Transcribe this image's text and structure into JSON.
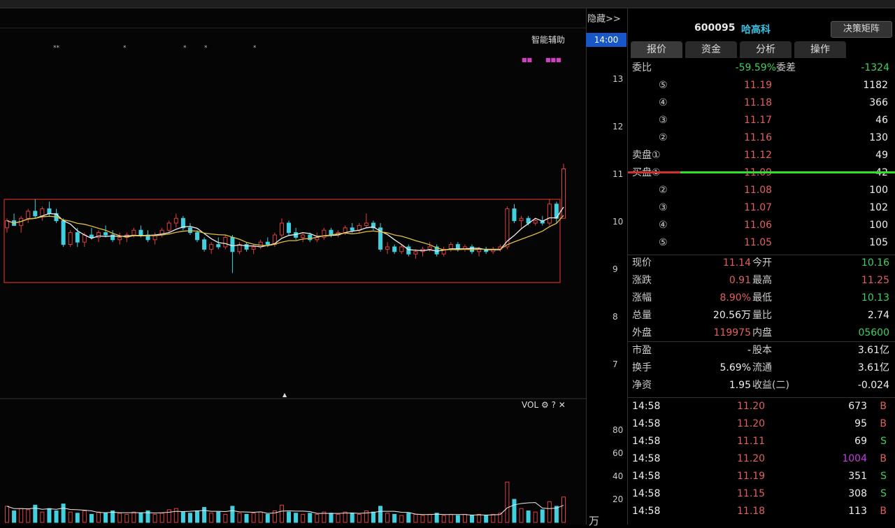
{
  "header": {
    "hide_label": "隐藏>>",
    "time_badge": "14:00",
    "smart_label": "智能辅助",
    "markers": [
      "**",
      "*",
      "*",
      "*",
      "*"
    ],
    "mag_labels": [
      "■■",
      "■■■"
    ]
  },
  "stock": {
    "code": "600095",
    "name": "哈高科",
    "matrix_button": "决策矩阵"
  },
  "tabs": [
    {
      "label": "报价"
    },
    {
      "label": "资金"
    },
    {
      "label": "分析"
    },
    {
      "label": "操作"
    }
  ],
  "ratio": {
    "label": "委比",
    "value": "-59.59%",
    "diff_label": "委差",
    "diff_value": "-1324"
  },
  "sell": [
    {
      "level": "⑤",
      "price": "11.19",
      "vol": "1182"
    },
    {
      "level": "④",
      "price": "11.18",
      "vol": "366"
    },
    {
      "level": "③",
      "price": "11.17",
      "vol": "46"
    },
    {
      "level": "②",
      "price": "11.16",
      "vol": "130"
    },
    {
      "level": "卖盘①",
      "price": "11.12",
      "vol": "49"
    }
  ],
  "buy": [
    {
      "level": "买盘①",
      "price": "11.09",
      "vol": "42"
    },
    {
      "level": "②",
      "price": "11.08",
      "vol": "100"
    },
    {
      "level": "③",
      "price": "11.07",
      "vol": "102"
    },
    {
      "level": "④",
      "price": "11.06",
      "vol": "100"
    },
    {
      "level": "⑤",
      "price": "11.05",
      "vol": "105"
    }
  ],
  "stats": [
    {
      "l1": "现价",
      "v1": "11.14",
      "c1": "red",
      "l2": "今开",
      "v2": "10.16",
      "c2": "grn"
    },
    {
      "l1": "涨跌",
      "v1": "0.91",
      "c1": "red",
      "l2": "最高",
      "v2": "11.25",
      "c2": "red"
    },
    {
      "l1": "涨幅",
      "v1": "8.90%",
      "c1": "red",
      "l2": "最低",
      "v2": "10.13",
      "c2": "grn"
    },
    {
      "l1": "总量",
      "v1": "20.56万",
      "c1": "wht",
      "l2": "量比",
      "v2": "2.74",
      "c2": "wht"
    },
    {
      "l1": "外盘",
      "v1": "119975",
      "c1": "red",
      "l2": "内盘",
      "v2": "05600",
      "c2": "grn"
    },
    {
      "l1": "市盈",
      "v1": "-",
      "c1": "wht",
      "l2": "股本",
      "v2": "3.61亿",
      "c2": "wht"
    },
    {
      "l1": "换手",
      "v1": "5.69%",
      "c1": "wht",
      "l2": "流通",
      "v2": "3.61亿",
      "c2": "wht"
    },
    {
      "l1": "净资",
      "v1": "1.95",
      "c1": "wht",
      "l2": "收益(二)",
      "v2": "-0.024",
      "c2": "wht"
    }
  ],
  "trades": [
    {
      "time": "14:58",
      "price": "11.20",
      "vol": "673",
      "bs": "B",
      "vc": "wht"
    },
    {
      "time": "14:58",
      "price": "11.20",
      "vol": "95",
      "bs": "B",
      "vc": "wht"
    },
    {
      "time": "14:58",
      "price": "11.11",
      "vol": "69",
      "bs": "S",
      "vc": "wht"
    },
    {
      "time": "14:58",
      "price": "11.20",
      "vol": "1004",
      "bs": "B",
      "vc": "pur"
    },
    {
      "time": "14:58",
      "price": "11.19",
      "vol": "351",
      "bs": "S",
      "vc": "wht"
    },
    {
      "time": "14:58",
      "price": "11.15",
      "vol": "308",
      "bs": "S",
      "vc": "wht"
    },
    {
      "time": "14:58",
      "price": "11.18",
      "vol": "113",
      "bs": "B",
      "vc": "wht"
    }
  ],
  "price_axis": [
    "13",
    "12",
    "11",
    "10",
    "9",
    "8",
    "7"
  ],
  "vol_panel": {
    "label": "VOL",
    "axis": [
      "80",
      "60",
      "40",
      "20"
    ],
    "unit": "万"
  },
  "colors": {
    "up": "#e04040",
    "down": "#40d0e0",
    "ma1": "#f0f0f0",
    "ma2": "#e0c040",
    "box": "#d03020"
  },
  "chart_data": {
    "type": "candlestick",
    "ylim": [
      6.5,
      13.5
    ],
    "box_range": [
      8.75,
      10.5
    ],
    "candles": [
      [
        9.9,
        10.1,
        9.8,
        10.05
      ],
      [
        10.05,
        10.2,
        9.95,
        9.95
      ],
      [
        9.95,
        10.15,
        9.8,
        10.1
      ],
      [
        10.1,
        10.3,
        10.0,
        10.25
      ],
      [
        10.25,
        10.5,
        10.1,
        10.15
      ],
      [
        10.15,
        10.35,
        10.05,
        10.3
      ],
      [
        10.3,
        10.45,
        10.15,
        10.2
      ],
      [
        10.2,
        10.3,
        10.0,
        10.05
      ],
      [
        10.05,
        10.1,
        9.5,
        9.55
      ],
      [
        9.55,
        9.85,
        9.5,
        9.8
      ],
      [
        9.8,
        9.9,
        9.5,
        9.6
      ],
      [
        9.6,
        9.8,
        9.5,
        9.75
      ],
      [
        9.75,
        9.9,
        9.65,
        9.7
      ],
      [
        9.7,
        9.85,
        9.6,
        9.8
      ],
      [
        9.8,
        9.95,
        9.7,
        9.75
      ],
      [
        9.75,
        9.85,
        9.6,
        9.65
      ],
      [
        9.65,
        9.8,
        9.55,
        9.7
      ],
      [
        9.7,
        9.8,
        9.6,
        9.75
      ],
      [
        9.75,
        9.9,
        9.7,
        9.85
      ],
      [
        9.85,
        9.95,
        9.7,
        9.75
      ],
      [
        9.75,
        9.85,
        9.6,
        9.65
      ],
      [
        9.65,
        9.8,
        9.55,
        9.75
      ],
      [
        9.75,
        9.9,
        9.7,
        9.85
      ],
      [
        9.85,
        10.05,
        9.8,
        10.0
      ],
      [
        10.0,
        10.2,
        9.9,
        10.1
      ],
      [
        10.1,
        10.15,
        9.85,
        9.9
      ],
      [
        9.9,
        10.0,
        9.75,
        9.8
      ],
      [
        9.8,
        9.85,
        9.6,
        9.65
      ],
      [
        9.65,
        9.7,
        9.4,
        9.45
      ],
      [
        9.45,
        9.6,
        9.35,
        9.55
      ],
      [
        9.55,
        9.7,
        9.45,
        9.5
      ],
      [
        9.5,
        9.75,
        9.45,
        9.7
      ],
      [
        9.7,
        9.75,
        8.95,
        9.4
      ],
      [
        9.4,
        9.6,
        9.35,
        9.55
      ],
      [
        9.55,
        9.6,
        9.4,
        9.45
      ],
      [
        9.45,
        9.55,
        9.35,
        9.5
      ],
      [
        9.5,
        9.65,
        9.45,
        9.6
      ],
      [
        9.6,
        9.7,
        9.5,
        9.55
      ],
      [
        9.55,
        9.8,
        9.5,
        9.75
      ],
      [
        9.75,
        10.1,
        9.7,
        10.0
      ],
      [
        10.0,
        10.05,
        9.75,
        9.8
      ],
      [
        9.8,
        9.9,
        9.65,
        9.7
      ],
      [
        9.7,
        9.8,
        9.6,
        9.75
      ],
      [
        9.75,
        9.8,
        9.6,
        9.65
      ],
      [
        9.65,
        9.8,
        9.6,
        9.7
      ],
      [
        9.7,
        9.9,
        9.65,
        9.85
      ],
      [
        9.85,
        9.9,
        9.7,
        9.75
      ],
      [
        9.75,
        9.85,
        9.7,
        9.8
      ],
      [
        9.8,
        9.95,
        9.75,
        9.9
      ],
      [
        9.9,
        10.0,
        9.8,
        9.85
      ],
      [
        9.85,
        10.0,
        9.8,
        9.95
      ],
      [
        9.95,
        10.2,
        9.9,
        10.0
      ],
      [
        10.0,
        10.05,
        9.85,
        9.9
      ],
      [
        9.9,
        10.0,
        9.4,
        9.45
      ],
      [
        9.45,
        9.6,
        9.35,
        9.5
      ],
      [
        9.5,
        9.55,
        9.35,
        9.4
      ],
      [
        9.4,
        9.55,
        9.35,
        9.5
      ],
      [
        9.5,
        9.55,
        9.3,
        9.35
      ],
      [
        9.35,
        9.45,
        9.25,
        9.4
      ],
      [
        9.4,
        9.5,
        9.3,
        9.45
      ],
      [
        9.45,
        9.6,
        9.4,
        9.5
      ],
      [
        9.5,
        9.55,
        9.3,
        9.35
      ],
      [
        9.35,
        9.5,
        9.3,
        9.45
      ],
      [
        9.45,
        9.6,
        9.4,
        9.55
      ],
      [
        9.55,
        9.6,
        9.4,
        9.45
      ],
      [
        9.45,
        9.55,
        9.4,
        9.5
      ],
      [
        9.5,
        9.55,
        9.35,
        9.4
      ],
      [
        9.4,
        9.5,
        9.3,
        9.45
      ],
      [
        9.45,
        9.5,
        9.35,
        9.4
      ],
      [
        9.4,
        9.5,
        9.35,
        9.45
      ],
      [
        9.45,
        9.55,
        9.4,
        9.5
      ],
      [
        9.5,
        10.35,
        9.45,
        10.3
      ],
      [
        10.3,
        10.4,
        10.0,
        10.05
      ],
      [
        10.05,
        10.15,
        9.9,
        10.1
      ],
      [
        10.1,
        10.15,
        9.95,
        10.0
      ],
      [
        10.0,
        10.1,
        9.95,
        10.05
      ],
      [
        10.05,
        10.15,
        9.95,
        10.0
      ],
      [
        10.0,
        10.5,
        9.95,
        10.4
      ],
      [
        10.4,
        10.45,
        10.0,
        10.1
      ],
      [
        10.1,
        11.25,
        10.1,
        11.14
      ]
    ],
    "volumes": [
      14,
      10,
      12,
      11,
      15,
      9,
      12,
      10,
      16,
      9,
      8,
      10,
      7,
      9,
      8,
      10,
      8,
      7,
      9,
      8,
      10,
      7,
      8,
      11,
      12,
      9,
      8,
      10,
      13,
      8,
      9,
      7,
      14,
      8,
      7,
      8,
      9,
      7,
      10,
      15,
      9,
      8,
      7,
      8,
      7,
      9,
      8,
      7,
      9,
      8,
      7,
      10,
      9,
      14,
      8,
      7,
      6,
      8,
      7,
      6,
      7,
      8,
      6,
      7,
      6,
      7,
      6,
      7,
      6,
      7,
      8,
      35,
      20,
      12,
      10,
      9,
      11,
      18,
      14,
      22
    ]
  }
}
